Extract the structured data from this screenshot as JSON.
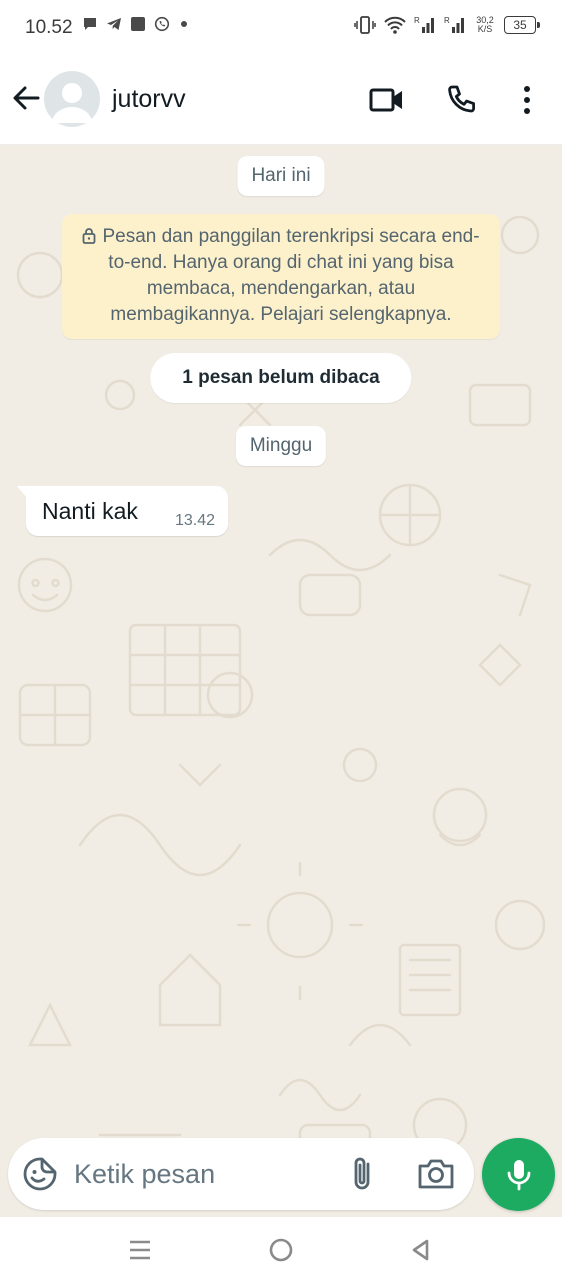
{
  "status_bar": {
    "time": "10.52",
    "speed_value": "30,2",
    "speed_unit": "K/S",
    "battery": "35",
    "left_icons": [
      "chat-bubble-icon",
      "telegram-icon",
      "gallery-icon",
      "whatsapp-icon",
      "dot-icon"
    ],
    "right_icons": [
      "vibrate-icon",
      "wifi-icon",
      "signal-icon",
      "signal-icon"
    ]
  },
  "header": {
    "contact_name": "jutorvv",
    "icons": [
      "back-arrow-icon",
      "avatar-icon",
      "video-call-icon",
      "phone-icon",
      "more-vert-icon"
    ]
  },
  "chat": {
    "date_today": "Hari ini",
    "encryption_notice": "Pesan dan panggilan terenkripsi secara end-to-end. Hanya orang di chat ini yang bisa membaca, mendengarkan, atau membagikannya. Pelajari selengkapnya.",
    "unread_banner": "1 pesan belum dibaca",
    "date_sunday": "Minggu",
    "messages": [
      {
        "direction": "incoming",
        "text": "Nanti kak",
        "time": "13.42"
      }
    ]
  },
  "composer": {
    "placeholder": "Ketik pesan",
    "value": "",
    "icons": [
      "sticker-icon",
      "paperclip-icon",
      "camera-icon",
      "microphone-icon"
    ]
  },
  "nav_bar": {
    "icons": [
      "recent-apps-icon",
      "home-icon",
      "back-icon"
    ]
  },
  "colors": {
    "accent_green": "#1daa61",
    "chat_background": "#f1ede4",
    "notice_background": "#fdf1cc",
    "timestamp_gray": "#667781"
  }
}
